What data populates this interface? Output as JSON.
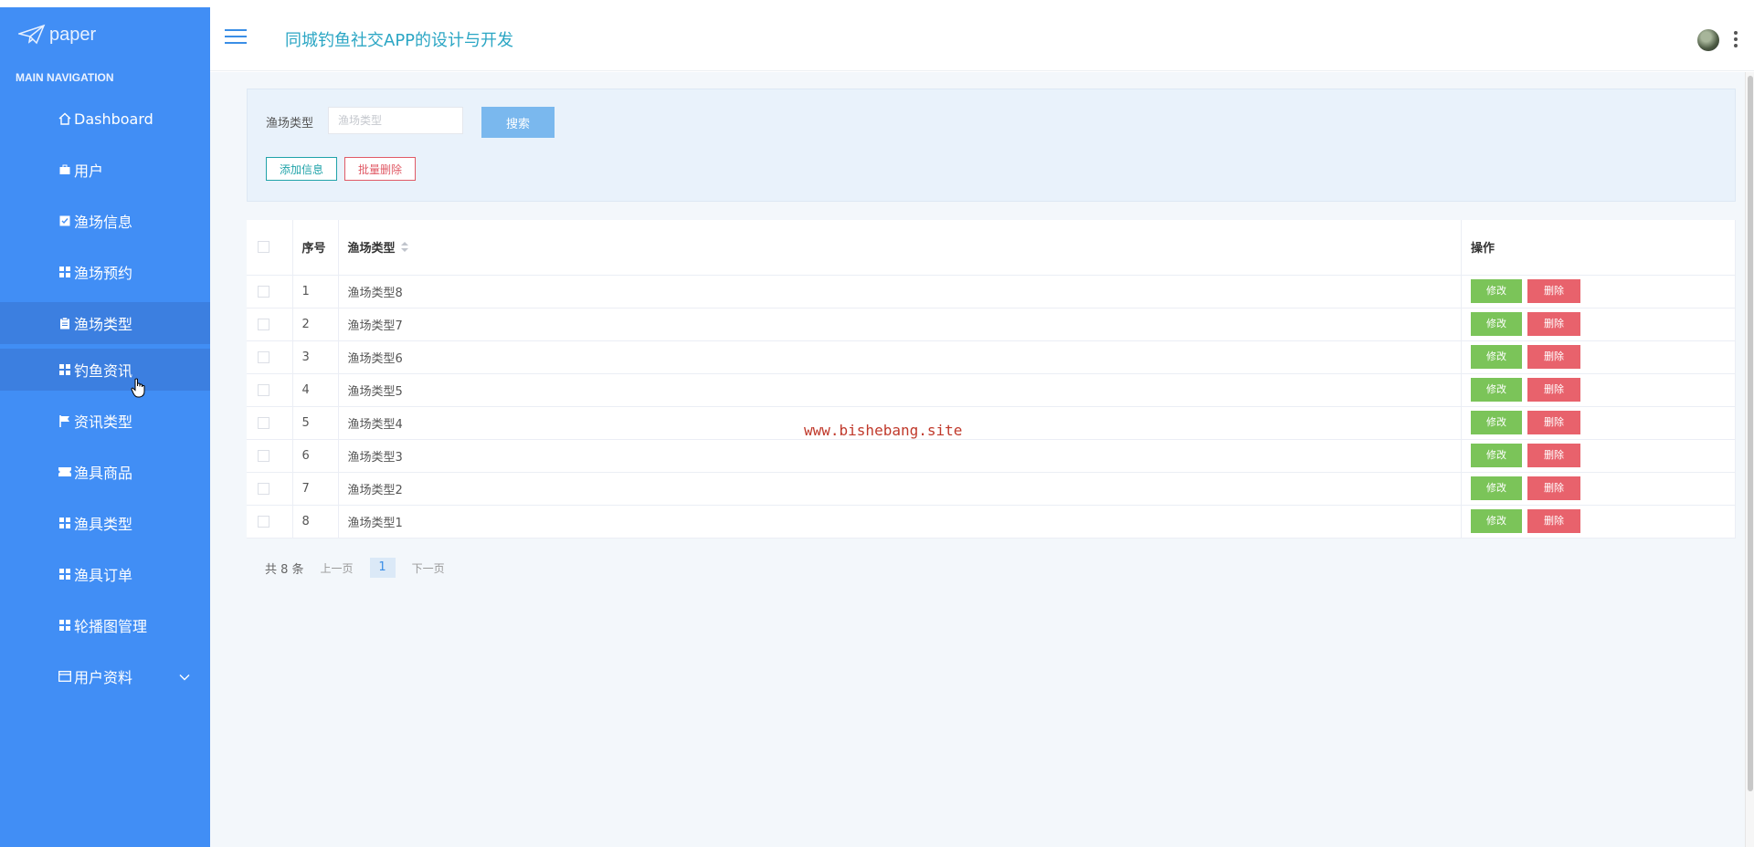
{
  "sidebar": {
    "logo_text": "paper",
    "nav_header": "MAIN NAVIGATION",
    "items": [
      {
        "label": "Dashboard",
        "icon": "home-icon"
      },
      {
        "label": "用户",
        "icon": "briefcase-icon"
      },
      {
        "label": "渔场信息",
        "icon": "checkbox-icon"
      },
      {
        "label": "渔场预约",
        "icon": "grid-icon"
      },
      {
        "label": "渔场类型",
        "icon": "clipboard-icon"
      },
      {
        "label": "钓鱼资讯",
        "icon": "grid-icon"
      },
      {
        "label": "资讯类型",
        "icon": "flag-icon"
      },
      {
        "label": "渔具商品",
        "icon": "ticket-icon"
      },
      {
        "label": "渔具类型",
        "icon": "grid-icon"
      },
      {
        "label": "渔具订单",
        "icon": "grid-icon"
      },
      {
        "label": "轮播图管理",
        "icon": "grid-icon"
      },
      {
        "label": "用户资料",
        "icon": "window-icon"
      }
    ]
  },
  "header": {
    "title": "同城钓鱼社交APP的设计与开发"
  },
  "search": {
    "label": "渔场类型",
    "placeholder": "渔场类型",
    "button": "搜索"
  },
  "actions": {
    "add": "添加信息",
    "batch_delete": "批量删除"
  },
  "table": {
    "headers": {
      "index": "序号",
      "type": "渔场类型",
      "ops": "操作"
    },
    "edit_label": "修改",
    "delete_label": "删除",
    "rows": [
      {
        "index": "1",
        "type": "渔场类型8"
      },
      {
        "index": "2",
        "type": "渔场类型7"
      },
      {
        "index": "3",
        "type": "渔场类型6"
      },
      {
        "index": "4",
        "type": "渔场类型5"
      },
      {
        "index": "5",
        "type": "渔场类型4"
      },
      {
        "index": "6",
        "type": "渔场类型3"
      },
      {
        "index": "7",
        "type": "渔场类型2"
      },
      {
        "index": "8",
        "type": "渔场类型1"
      }
    ]
  },
  "pagination": {
    "total": "共 8 条",
    "prev": "上一页",
    "page": "1",
    "next": "下一页"
  },
  "watermark": "www.bishebang.site",
  "colors": {
    "sidebar": "#418ef5",
    "sidebar_active": "#3c7fe0",
    "title": "#2ba6c4",
    "edit": "#7bc459",
    "delete": "#e8626c"
  }
}
